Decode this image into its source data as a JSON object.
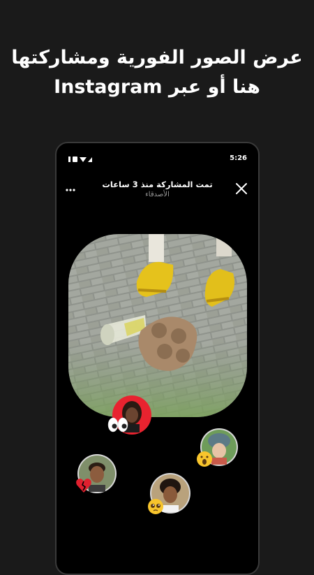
{
  "headline": {
    "line1": "عرض الصور الفورية ومشاركتها",
    "line2": "هنا أو عبر Instagram"
  },
  "phone": {
    "status": {
      "time": "5:26"
    },
    "header": {
      "title": "تمت المشاركة منذ 3 ساعات",
      "subtitle": "الأصدقاء"
    },
    "photo": {
      "description_icon": "shared-photo"
    },
    "reactions": [
      {
        "name": "reaction-woman-red",
        "emoji": "eyes-emoji",
        "ring": "#e8232f"
      },
      {
        "name": "reaction-beanie",
        "emoji": "surprised-face-emoji",
        "ring": "#d8d8d8"
      },
      {
        "name": "reaction-man-left",
        "emoji": "broken-heart-emoji",
        "ring": "#d8d8d8"
      },
      {
        "name": "reaction-man-curly",
        "emoji": "pleading-face-emoji",
        "ring": "#d8d8d8"
      }
    ]
  },
  "colors": {
    "background": "#1a1a1a",
    "phone": "#000000",
    "accent_red": "#e8232f"
  }
}
